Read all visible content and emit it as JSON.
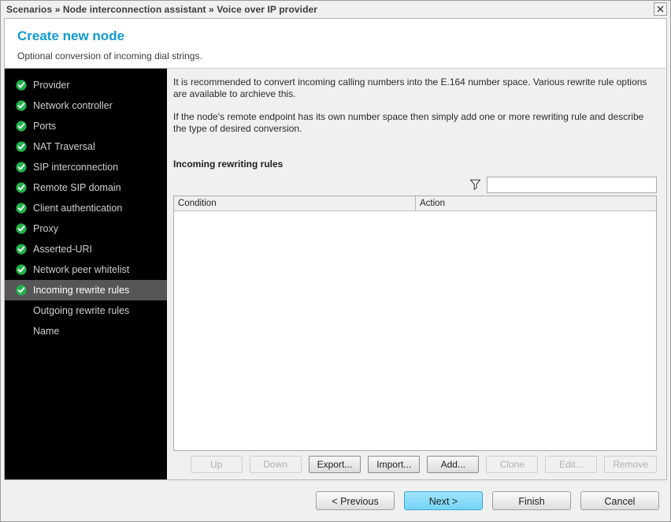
{
  "window": {
    "breadcrumb": "Scenarios » Node interconnection assistant » Voice over IP provider",
    "close_label": "X"
  },
  "header": {
    "title": "Create new node",
    "subtitle": "Optional conversion of incoming dial strings.",
    "title_color": "#0e9bd1"
  },
  "sidebar": {
    "items": [
      {
        "label": "Provider",
        "completed": true,
        "selected": false
      },
      {
        "label": "Network controller",
        "completed": true,
        "selected": false
      },
      {
        "label": "Ports",
        "completed": true,
        "selected": false
      },
      {
        "label": "NAT Traversal",
        "completed": true,
        "selected": false
      },
      {
        "label": "SIP interconnection",
        "completed": true,
        "selected": false
      },
      {
        "label": "Remote SIP domain",
        "completed": true,
        "selected": false
      },
      {
        "label": "Client authentication",
        "completed": true,
        "selected": false
      },
      {
        "label": "Proxy",
        "completed": true,
        "selected": false
      },
      {
        "label": "Asserted-URI",
        "completed": true,
        "selected": false
      },
      {
        "label": "Network peer whitelist",
        "completed": true,
        "selected": false
      },
      {
        "label": "Incoming rewrite rules",
        "completed": true,
        "selected": true
      },
      {
        "label": "Outgoing rewrite rules",
        "completed": false,
        "selected": false
      },
      {
        "label": "Name",
        "completed": false,
        "selected": false
      }
    ],
    "check_color": "#22b34a",
    "selected_bg": "#565656"
  },
  "main": {
    "paragraph1": "It is recommended to convert incoming calling numbers into the E.164 number space. Various rewrite rule options are available to archieve this.",
    "paragraph2": "If the node's remote endpoint has its own number space then simply add one or more rewriting rule and describe the type of desired conversion.",
    "rules_label": "Incoming rewriting rules",
    "filter": {
      "icon": "funnel-icon",
      "value": "",
      "placeholder": ""
    },
    "table": {
      "columns": [
        "Condition",
        "Action"
      ],
      "rows": []
    },
    "table_buttons": [
      {
        "label": "Up",
        "enabled": false
      },
      {
        "label": "Down",
        "enabled": false
      },
      {
        "label": "Export...",
        "enabled": true
      },
      {
        "label": "Import...",
        "enabled": true
      },
      {
        "label": "Add...",
        "enabled": true
      },
      {
        "label": "Clone",
        "enabled": false
      },
      {
        "label": "Edit...",
        "enabled": false
      },
      {
        "label": "Remove",
        "enabled": false
      }
    ]
  },
  "footer": {
    "buttons": [
      {
        "label": "< Previous",
        "primary": false
      },
      {
        "label": "Next >",
        "primary": true
      },
      {
        "label": "Finish",
        "primary": false
      },
      {
        "label": "Cancel",
        "primary": false
      }
    ],
    "primary_color": "#76d4f7"
  }
}
